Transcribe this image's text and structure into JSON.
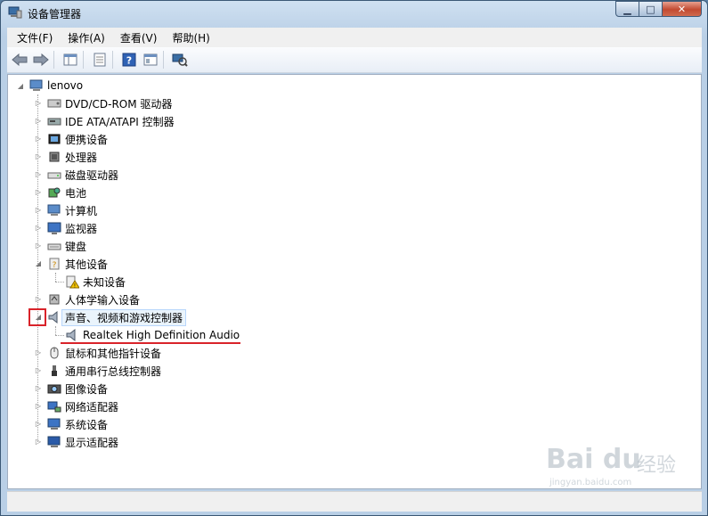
{
  "window": {
    "title": "设备管理器"
  },
  "caption_buttons": {
    "minimize": "▁",
    "maximize": "□",
    "close": "✕"
  },
  "menu": [
    "文件(F)",
    "操作(A)",
    "查看(V)",
    "帮助(H)"
  ],
  "toolbar_icons": [
    "back-arrow-icon",
    "forward-arrow-icon",
    "show-hide-console-tree-icon",
    "properties-icon",
    "help-icon",
    "view-icon",
    "scan-hardware-icon"
  ],
  "tree": {
    "root": "lenovo",
    "categories": [
      {
        "label": "DVD/CD-ROM 驱动器",
        "icon": "dvd-drive-icon",
        "expanded": false
      },
      {
        "label": "IDE ATA/ATAPI 控制器",
        "icon": "ide-controller-icon",
        "expanded": false
      },
      {
        "label": "便携设备",
        "icon": "portable-device-icon",
        "expanded": false
      },
      {
        "label": "处理器",
        "icon": "processor-icon",
        "expanded": false
      },
      {
        "label": "磁盘驱动器",
        "icon": "disk-drive-icon",
        "expanded": false
      },
      {
        "label": "电池",
        "icon": "battery-icon",
        "expanded": false
      },
      {
        "label": "计算机",
        "icon": "computer-icon",
        "expanded": false
      },
      {
        "label": "监视器",
        "icon": "monitor-icon",
        "expanded": false
      },
      {
        "label": "键盘",
        "icon": "keyboard-icon",
        "expanded": false
      },
      {
        "label": "其他设备",
        "icon": "other-devices-icon",
        "expanded": true,
        "children": [
          {
            "label": "未知设备",
            "icon": "unknown-device-warning-icon"
          }
        ]
      },
      {
        "label": "人体学输入设备",
        "icon": "hid-icon",
        "expanded": false
      },
      {
        "label": "声音、视频和游戏控制器",
        "icon": "speaker-icon",
        "expanded": true,
        "selected": true,
        "children": [
          {
            "label": "Realtek High Definition Audio",
            "icon": "speaker-icon"
          }
        ]
      },
      {
        "label": "鼠标和其他指针设备",
        "icon": "mouse-icon",
        "expanded": false
      },
      {
        "label": "通用串行总线控制器",
        "icon": "usb-icon",
        "expanded": false
      },
      {
        "label": "图像设备",
        "icon": "camera-icon",
        "expanded": false
      },
      {
        "label": "网络适配器",
        "icon": "network-adapter-icon",
        "expanded": false
      },
      {
        "label": "系统设备",
        "icon": "system-device-icon",
        "expanded": false
      },
      {
        "label": "显示适配器",
        "icon": "display-adapter-icon",
        "expanded": false
      }
    ]
  },
  "watermark": {
    "brand": "Bai du",
    "cn": "经验",
    "url": "jingyan.baidu.com"
  },
  "colors": {
    "annotation_red": "#d9232a",
    "selection_bg": "#eaf4fc"
  }
}
